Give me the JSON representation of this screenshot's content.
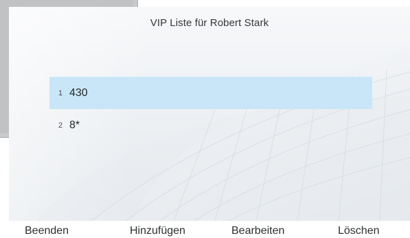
{
  "screen": {
    "title": "VIP Liste für Robert Stark"
  },
  "list": {
    "items": [
      {
        "index": "1",
        "value": "430",
        "selected": true
      },
      {
        "index": "2",
        "value": "8*",
        "selected": false
      }
    ]
  },
  "softkeys": {
    "exit": "Beenden",
    "add": "Hinzufügen",
    "edit": "Bearbeiten",
    "delete": "Löschen"
  },
  "colors": {
    "selection": "#c8e6f7",
    "text": "#25282a",
    "background_window": "#c7c9cb"
  }
}
